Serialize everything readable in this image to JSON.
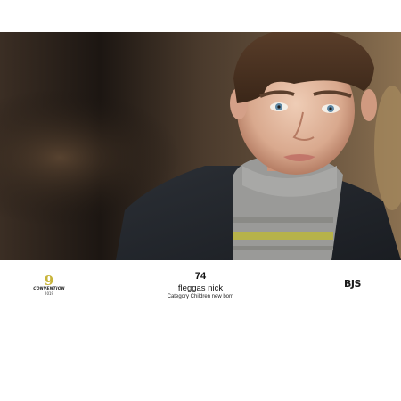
{
  "entry": {
    "number": "74",
    "name": "fleggas nick",
    "category": "Category Children new born"
  },
  "logo_left": {
    "mark": "9",
    "brand": "CONVENTION",
    "year": "2019"
  },
  "logo_right": {
    "mark": "BJS"
  },
  "colors": {
    "background": "#ffffff",
    "photo_dark": "#2a221c",
    "logo_gold": "#c8b43a",
    "text": "#111111"
  }
}
